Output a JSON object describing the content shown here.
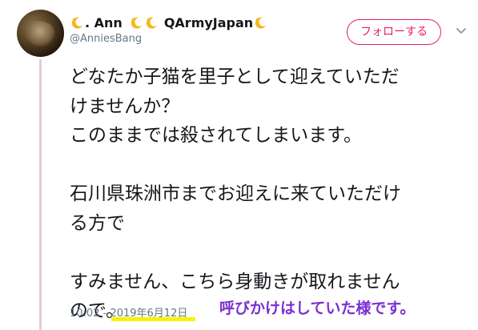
{
  "tweet": {
    "display_name_part1": ". Ann",
    "display_name_part2": "QArmyJapan",
    "handle": "@AnniesBang",
    "follow_label": "フォローする",
    "lines": [
      "どなたか子猫を里子として迎えていただ",
      "けませんか？",
      "このままでは殺されてしまいます。",
      "",
      "石川県珠洲市までお迎えに来ていただけ",
      "る方で",
      "",
      "すみません、こちら身動きが取れません",
      "ので。"
    ],
    "time": "10:02",
    "separator": "-",
    "date": "2019年6月12日"
  },
  "annotation": {
    "text": "呼びかけはしていた様です。",
    "color": "#7b2fd3"
  },
  "colors": {
    "follow_accent": "#e0245e",
    "thread_line": "#e8c8dc",
    "highlight": "#f6f300"
  },
  "icons": {
    "name_emoji": "crescent-moon-icon",
    "menu": "chevron-down-icon"
  }
}
